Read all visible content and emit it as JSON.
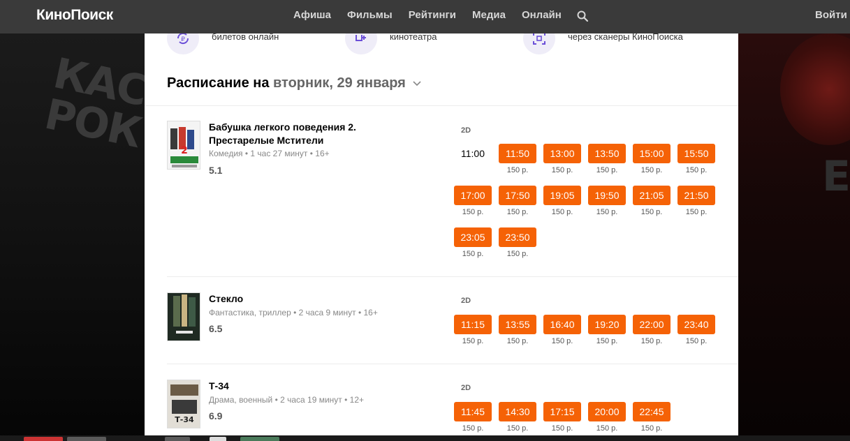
{
  "header": {
    "logo": "КиноПоиск",
    "nav": [
      "Афиша",
      "Фильмы",
      "Рейтинги",
      "Медиа",
      "Онлайн"
    ],
    "login": "Войти",
    "search_icon": "search-icon"
  },
  "features": [
    {
      "icon": "ticket-refresh-icon",
      "line2": "билетов онлайн"
    },
    {
      "icon": "chair-plus-icon",
      "line2": "кинотеатра"
    },
    {
      "icon": "scan-icon",
      "line2": "через сканеры КиноПоиска"
    }
  ],
  "schedule": {
    "title_prefix": "Расписание на",
    "date": "вторник, 29 января"
  },
  "movies": [
    {
      "title": "Бабушка легкого поведения 2. Престарелые Мстители",
      "meta": "Комедия • 1 час 27 минут • 16+",
      "rating": "5.1",
      "format": "2D",
      "poster_colors": [
        "#ffffff",
        "#d23a2e",
        "#1e4d9a"
      ],
      "sessions": [
        {
          "time": "11:00",
          "price": "",
          "available": false
        },
        {
          "time": "11:50",
          "price": "150 р.",
          "available": true
        },
        {
          "time": "13:00",
          "price": "150 р.",
          "available": true
        },
        {
          "time": "13:50",
          "price": "150 р.",
          "available": true
        },
        {
          "time": "15:00",
          "price": "150 р.",
          "available": true
        },
        {
          "time": "15:50",
          "price": "150 р.",
          "available": true
        },
        {
          "time": "17:00",
          "price": "150 р.",
          "available": true
        },
        {
          "time": "17:50",
          "price": "150 р.",
          "available": true
        },
        {
          "time": "19:05",
          "price": "150 р.",
          "available": true
        },
        {
          "time": "19:50",
          "price": "150 р.",
          "available": true
        },
        {
          "time": "21:05",
          "price": "150 р.",
          "available": true
        },
        {
          "time": "21:50",
          "price": "150 р.",
          "available": true
        },
        {
          "time": "23:05",
          "price": "150 р.",
          "available": true
        },
        {
          "time": "23:50",
          "price": "150 р.",
          "available": true
        }
      ]
    },
    {
      "title": "Стекло",
      "meta": "Фантастика, триллер • 2 часа 9 минут • 16+",
      "rating": "6.5",
      "format": "2D",
      "poster_colors": [
        "#2a3a2c",
        "#5c6b4d",
        "#c9b483"
      ],
      "sessions": [
        {
          "time": "11:15",
          "price": "150 р.",
          "available": true
        },
        {
          "time": "13:55",
          "price": "150 р.",
          "available": true
        },
        {
          "time": "16:40",
          "price": "150 р.",
          "available": true
        },
        {
          "time": "19:20",
          "price": "150 р.",
          "available": true
        },
        {
          "time": "22:00",
          "price": "150 р.",
          "available": true
        },
        {
          "time": "23:40",
          "price": "150 р.",
          "available": true
        }
      ]
    },
    {
      "title": "Т-34",
      "meta": "Драма, военный • 2 часа 19 минут • 12+",
      "rating": "6.9",
      "format": "2D",
      "poster_colors": [
        "#d9d6cf",
        "#6b5b46",
        "#222222"
      ],
      "sessions": [
        {
          "time": "11:45",
          "price": "150 р.",
          "available": true
        },
        {
          "time": "14:30",
          "price": "150 р.",
          "available": true
        },
        {
          "time": "17:15",
          "price": "150 р.",
          "available": true
        },
        {
          "time": "20:00",
          "price": "150 р.",
          "available": true
        },
        {
          "time": "22:45",
          "price": "150 р.",
          "available": true
        }
      ]
    }
  ]
}
